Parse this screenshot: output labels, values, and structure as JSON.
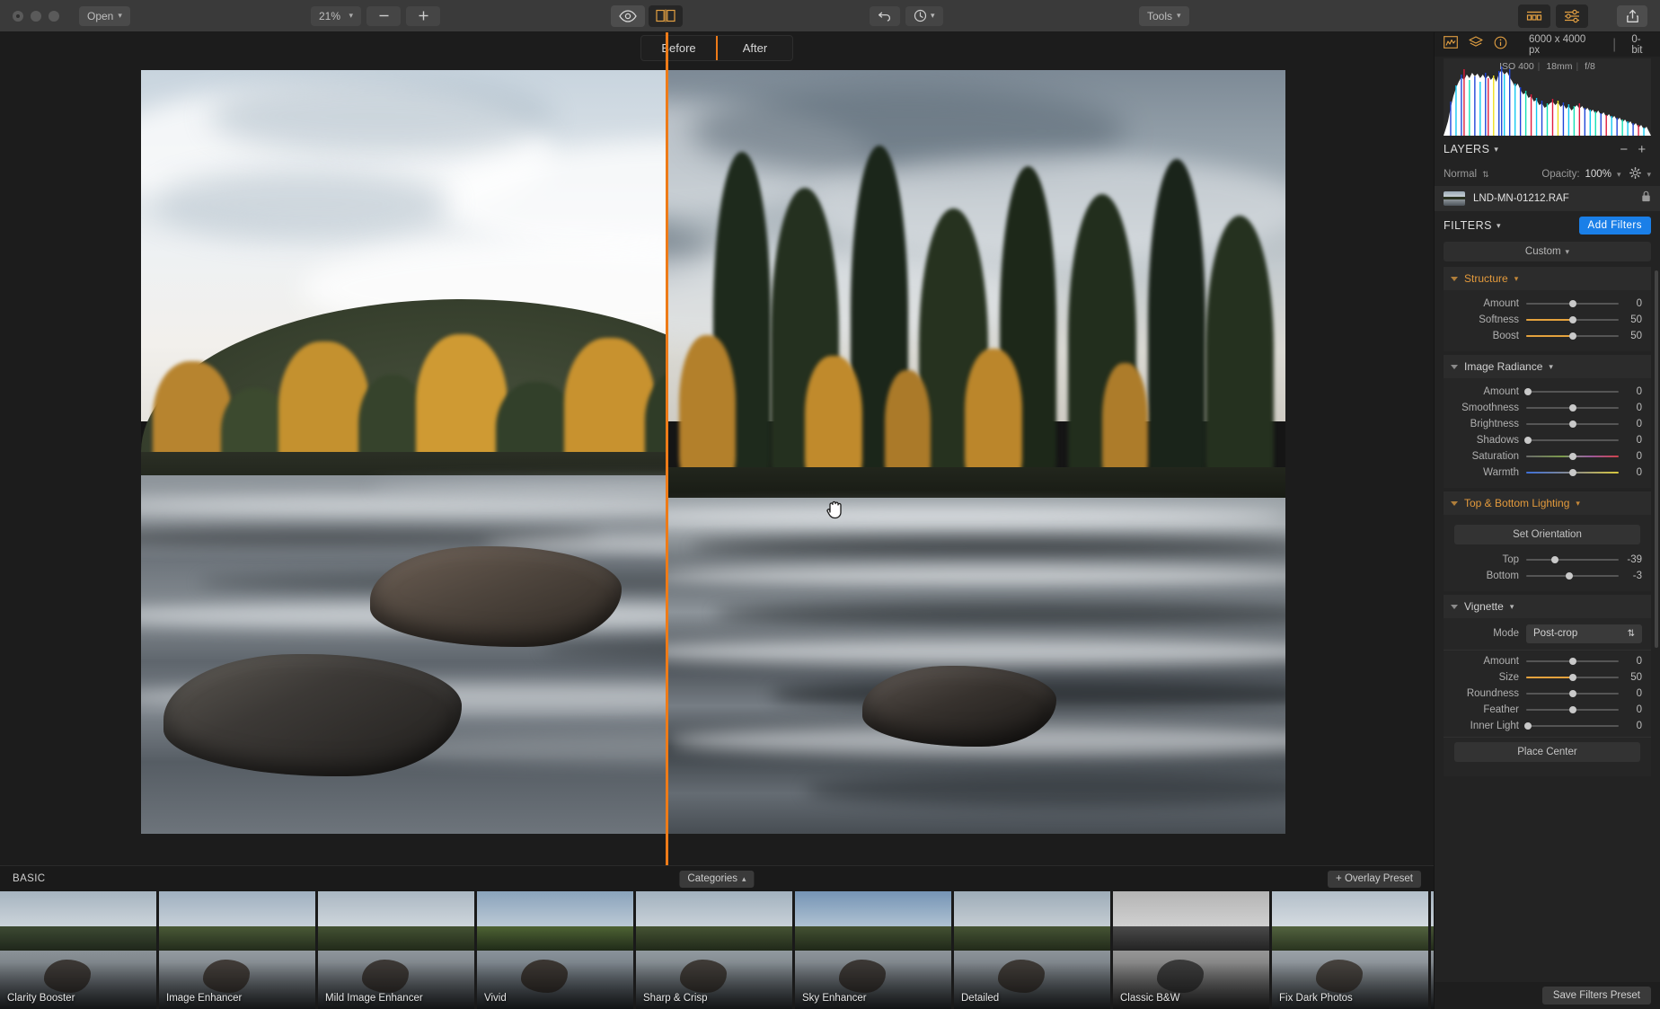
{
  "toolbar": {
    "open_label": "Open",
    "zoom_level": "21%",
    "zoom_out_label": "−",
    "zoom_in_label": "+",
    "eye_icon": "eye-icon",
    "compare_icon": "split-compare-icon",
    "undo_icon": "undo-icon",
    "history_icon": "history-clock-icon",
    "tools_label": "Tools",
    "presets_icon": "presets-filmstrip-icon",
    "adjust_icon": "adjustments-sliders-icon",
    "share_icon": "share-export-icon"
  },
  "canvas": {
    "before_label": "Before",
    "after_label": "After",
    "cursor": "hand-pan-cursor",
    "divider_color": "#ee7b18"
  },
  "info": {
    "histogram_icon": "histogram-icon",
    "layers_icon": "layers-stack-icon",
    "info_icon": "info-circle-icon",
    "dimensions": "6000 x 4000 px",
    "separator": "|",
    "bit_depth": "0-bit",
    "exif": {
      "iso": "ISO 400",
      "focal": "18mm",
      "aperture": "f/8"
    }
  },
  "layers": {
    "title": "LAYERS",
    "remove_label": "−",
    "add_label": "+",
    "blend_mode": "Normal",
    "opacity_label": "Opacity:",
    "opacity_value": "100%",
    "gear_icon": "gear-icon",
    "items": [
      {
        "name": "LND-MN-01212.RAF",
        "locked": true,
        "lock_icon": "lock-icon"
      }
    ]
  },
  "filters": {
    "title": "FILTERS",
    "add_label": "Add Filters",
    "preset_selector": "Custom",
    "save_preset_label": "Save Filters Preset",
    "sections": [
      {
        "name": "Structure",
        "active": true,
        "expanded": true,
        "sliders": [
          {
            "label": "Amount",
            "value": 0,
            "pct": 50,
            "fill": false
          },
          {
            "label": "Softness",
            "value": 50,
            "pct": 50,
            "fill": true
          },
          {
            "label": "Boost",
            "value": 50,
            "pct": 50,
            "fill": true
          }
        ]
      },
      {
        "name": "Image Radiance",
        "active": false,
        "expanded": true,
        "sliders": [
          {
            "label": "Amount",
            "value": 0,
            "pct": 2,
            "fill": false
          },
          {
            "label": "Smoothness",
            "value": 0,
            "pct": 50,
            "fill": false
          },
          {
            "label": "Brightness",
            "value": 0,
            "pct": 50,
            "fill": false
          },
          {
            "label": "Shadows",
            "value": 0,
            "pct": 2,
            "fill": false
          },
          {
            "label": "Saturation",
            "value": 0,
            "pct": 50,
            "fill": false,
            "gradient": "saturation"
          },
          {
            "label": "Warmth",
            "value": 0,
            "pct": 50,
            "fill": false,
            "gradient": "warmth"
          }
        ]
      },
      {
        "name": "Top & Bottom Lighting",
        "active": true,
        "expanded": true,
        "button": "Set Orientation",
        "sliders": [
          {
            "label": "Top",
            "value": -39,
            "pct": 31,
            "fill": false
          },
          {
            "label": "Bottom",
            "value": -3,
            "pct": 47,
            "fill": false
          }
        ]
      },
      {
        "name": "Vignette",
        "active": false,
        "expanded": true,
        "mode_label": "Mode",
        "mode_value": "Post-crop",
        "button": "Place Center",
        "sliders": [
          {
            "label": "Amount",
            "value": 0,
            "pct": 50,
            "fill": false
          },
          {
            "label": "Size",
            "value": 50,
            "pct": 50,
            "fill": true
          },
          {
            "label": "Roundness",
            "value": 0,
            "pct": 50,
            "fill": false
          },
          {
            "label": "Feather",
            "value": 0,
            "pct": 50,
            "fill": false
          },
          {
            "label": "Inner Light",
            "value": 0,
            "pct": 2,
            "fill": false
          }
        ]
      }
    ]
  },
  "presets": {
    "category_title": "BASIC",
    "categories_label": "Categories",
    "overlay_label": "+ Overlay Preset",
    "items": [
      {
        "label": "Clarity Booster"
      },
      {
        "label": "Image Enhancer"
      },
      {
        "label": "Mild Image Enhancer"
      },
      {
        "label": "Vivid"
      },
      {
        "label": "Sharp & Crisp"
      },
      {
        "label": "Sky Enhancer"
      },
      {
        "label": "Detailed"
      },
      {
        "label": "Classic B&W"
      },
      {
        "label": "Fix Dark Photos"
      },
      {
        "label": ""
      }
    ]
  }
}
